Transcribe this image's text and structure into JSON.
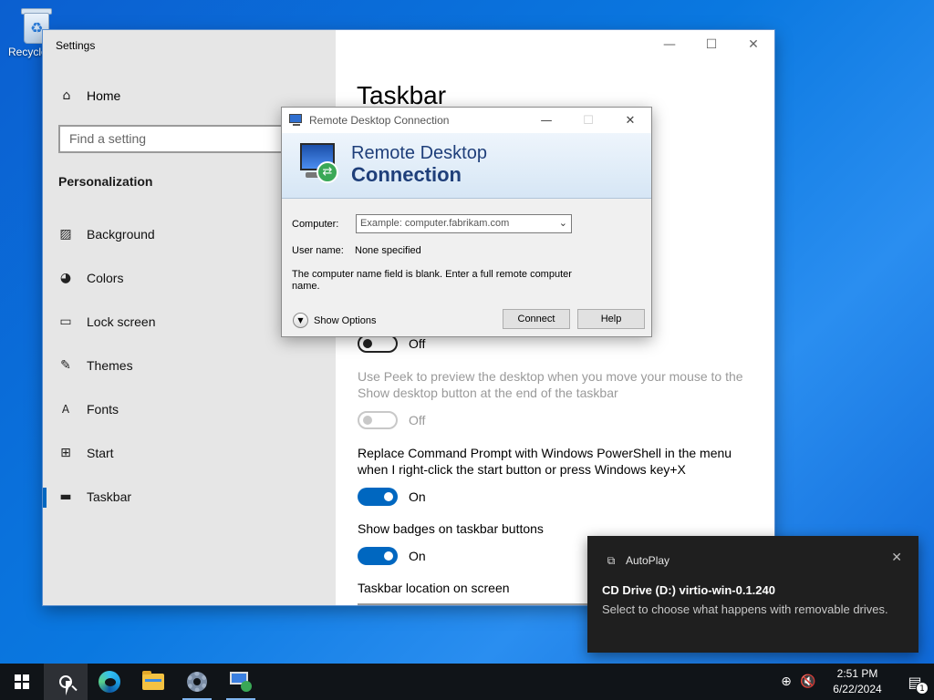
{
  "desktop": {
    "recycle_bin_label": "Recycle"
  },
  "settings": {
    "window_title": "Settings",
    "win_minimize": "—",
    "win_maximize": "☐",
    "win_close": "✕",
    "home_label": "Home",
    "search_placeholder": "Find a setting",
    "section_title": "Personalization",
    "nav_items": [
      {
        "label": "Background",
        "icon": "picture-icon"
      },
      {
        "label": "Colors",
        "icon": "palette-icon"
      },
      {
        "label": "Lock screen",
        "icon": "lock-screen-icon"
      },
      {
        "label": "Themes",
        "icon": "brush-icon"
      },
      {
        "label": "Fonts",
        "icon": "font-icon"
      },
      {
        "label": "Start",
        "icon": "start-icon"
      },
      {
        "label": "Taskbar",
        "icon": "taskbar-icon"
      }
    ],
    "page_title": "Taskbar",
    "toggle1_state": "Off",
    "peek_text": "Use Peek to preview the desktop when you move your mouse to the Show desktop button at the end of the taskbar",
    "toggle2_state": "Off",
    "powershell_text": "Replace Command Prompt with Windows PowerShell in the menu when I right-click the start button or press Windows key+X",
    "toggle3_state": "On",
    "badges_text": "Show badges on taskbar buttons",
    "toggle4_state": "On",
    "location_label": "Taskbar location on screen"
  },
  "rdc": {
    "title": "Remote Desktop Connection",
    "min": "—",
    "max": "☐",
    "close": "✕",
    "banner_line1": "Remote Desktop",
    "banner_line2": "Connection",
    "computer_label": "Computer:",
    "computer_placeholder": "Example: computer.fabrikam.com",
    "username_label": "User name:",
    "username_value": "None specified",
    "message": "The computer name field is blank. Enter a full remote computer name.",
    "show_options": "Show Options",
    "connect_button": "Connect",
    "help_button": "Help"
  },
  "toast": {
    "app": "AutoPlay",
    "title": "CD Drive (D:) virtio-win-0.1.240",
    "body": "Select to choose what happens with removable drives.",
    "close": "✕"
  },
  "taskbar": {
    "time": "2:51 PM",
    "date": "6/22/2024",
    "notification_count": "1"
  }
}
